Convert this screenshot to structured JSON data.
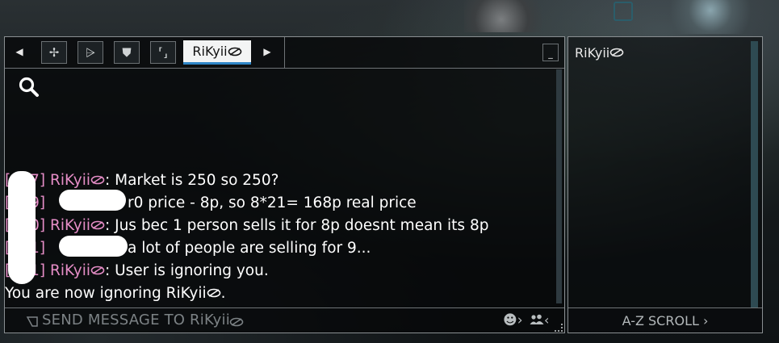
{
  "tabs": {
    "left_arrow": "◀",
    "right_arrow": "▶",
    "icons": [
      {
        "name": "clan-emblem-icon",
        "glyph": "✢"
      },
      {
        "name": "alliance-emblem-icon",
        "glyph": "⩥"
      },
      {
        "name": "shield-icon",
        "glyph": "⛊"
      },
      {
        "name": "trade-brackets-icon",
        "glyph": "⸢⸥"
      }
    ],
    "active_label": "RiKyii",
    "minimize_label": "_"
  },
  "messages": [
    {
      "time": "[ :07]",
      "author": "RiKyii",
      "text": ": Market is 250 so 250?"
    },
    {
      "time": "[ :09]",
      "author": "",
      "text": "r0 price - 8p, so 8*21= 168p real price"
    },
    {
      "time": "[ :10]",
      "author": "RiKyii",
      "text": ": Jus bec 1 person sells it for 8p doesnt mean its 8p"
    },
    {
      "time": "[ :11]",
      "author": "",
      "text": "a lot of people are selling for 9..."
    },
    {
      "time": "[ :11]",
      "author": "RiKyii",
      "text": ": User is ignoring you."
    }
  ],
  "system_message": {
    "prefix": "You are now ignoring RiKyii",
    "suffix": "."
  },
  "input": {
    "placeholder": "SEND MESSAGE TO RiKyii",
    "emoji_label": "☻›",
    "people_label": "‹"
  },
  "side_panel": {
    "user": "RiKyii",
    "az_scroll_label": "A-Z SCROLL ›"
  },
  "colors": {
    "author": "#e58dc6",
    "tab_active_underline": "#2f86c6",
    "placeholder": "#7c8285"
  }
}
